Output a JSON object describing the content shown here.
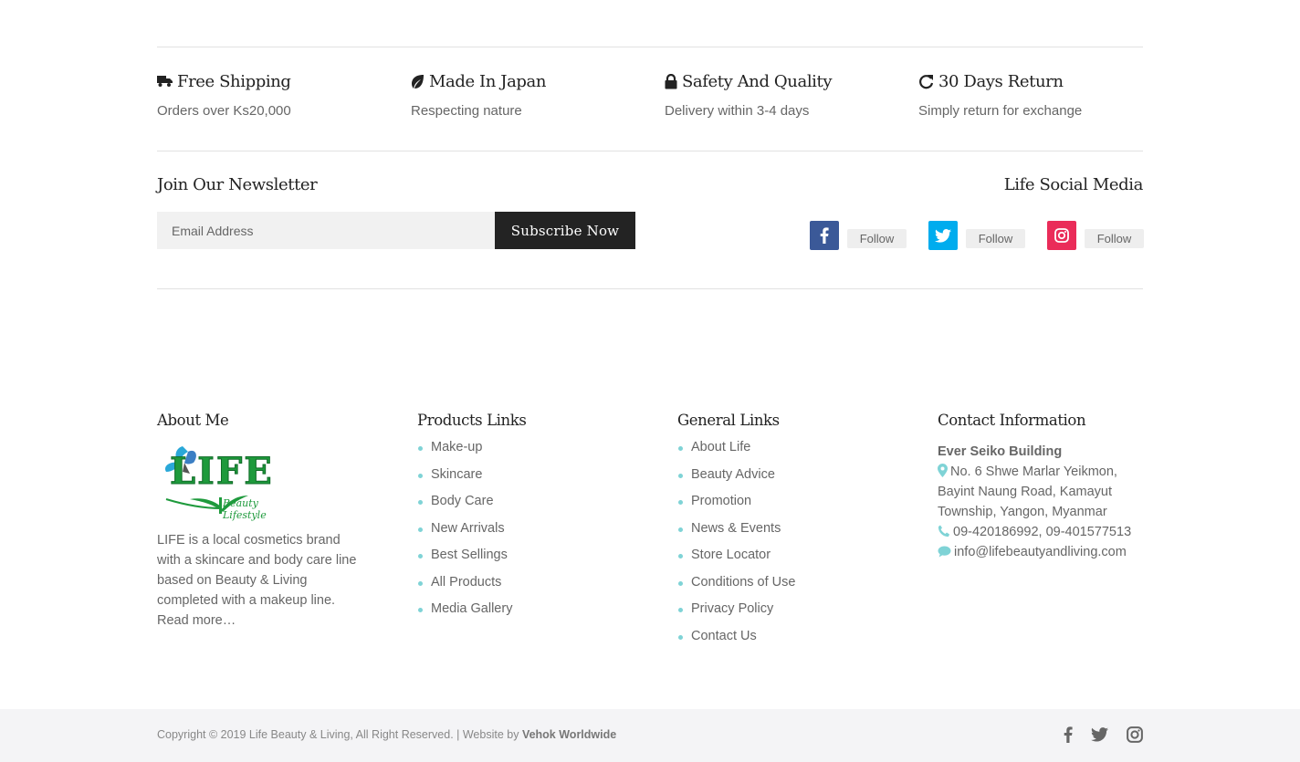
{
  "features": [
    {
      "title": "Free Shipping",
      "subtitle": "Orders over Ks20,000",
      "icon": "truck-icon"
    },
    {
      "title": "Made In Japan",
      "subtitle": "Respecting nature",
      "icon": "leaf-icon"
    },
    {
      "title": "Safety And Quality",
      "subtitle": "Delivery within 3-4 days",
      "icon": "lock-icon"
    },
    {
      "title": "30 Days Return",
      "subtitle": "Simply return for exchange",
      "icon": "refresh-icon"
    }
  ],
  "newsletter": {
    "title": "Join Our Newsletter",
    "placeholder": "Email Address",
    "button_label": "Subscribe Now"
  },
  "social_media": {
    "title": "Life Social Media",
    "items": [
      {
        "network": "facebook",
        "icon": "facebook-icon",
        "label": "Follow",
        "color": "#3b5998"
      },
      {
        "network": "twitter",
        "icon": "twitter-icon",
        "label": "Follow",
        "color": "#00acee"
      },
      {
        "network": "instagram",
        "icon": "instagram-icon",
        "label": "Follow",
        "color": "#ea2c59"
      }
    ]
  },
  "about": {
    "title": "About Me",
    "logo_text": "LIFE",
    "logo_tagline": "Beauty Lifestyle",
    "text": "LIFE is a local cosmetics brand with a skincare and body care line based on Beauty & Living completed with a makeup line.",
    "read_more": "Read more…"
  },
  "products_links": {
    "title": "Products Links",
    "items": [
      "Make-up",
      "Skincare",
      "Body Care",
      "New Arrivals",
      "Best Sellings",
      "All Products",
      "Media Gallery"
    ]
  },
  "general_links": {
    "title": "General Links",
    "items": [
      "About Life",
      "Beauty Advice",
      "Promotion",
      "News & Events",
      "Store Locator",
      "Conditions of Use",
      "Privacy Policy",
      "Contact Us"
    ]
  },
  "contact": {
    "title": "Contact Information",
    "building": "Ever Seiko Building",
    "address": "No. 6 Shwe Marlar Yeikmon, Bayint Naung Road, Kamayut Township, Yangon, Myanmar",
    "phone": "09-420186992, 09-401577513",
    "email": "info@lifebeautyandliving.com"
  },
  "footer": {
    "copyright": "Copyright © 2019 Life Beauty & Living, All Right Reserved. | Website by ",
    "credit": "Vehok Worldwide"
  },
  "colors": {
    "accent": "#7fd3d6",
    "button_bg": "#232323",
    "logo_green": "#1e9a3c",
    "logo_blue": "#2aa8d8"
  }
}
